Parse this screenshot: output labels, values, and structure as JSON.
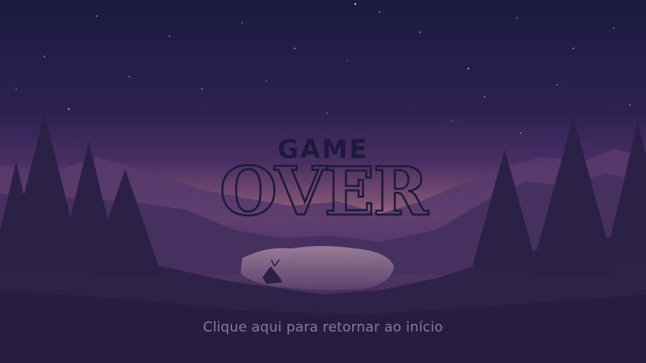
{
  "screen": {
    "title_line1": "GAME",
    "title_line2": "OVER",
    "return_link": "Clique aqui para retornar ao início"
  },
  "colors": {
    "sky_top": "#1b1a40",
    "sky_mid": "#3f2a5f",
    "horizon_glow": "#9b6f78",
    "title_fill": "#1d1b3c",
    "title_outline": "#1d1b3c",
    "link": "#8f74a3"
  }
}
